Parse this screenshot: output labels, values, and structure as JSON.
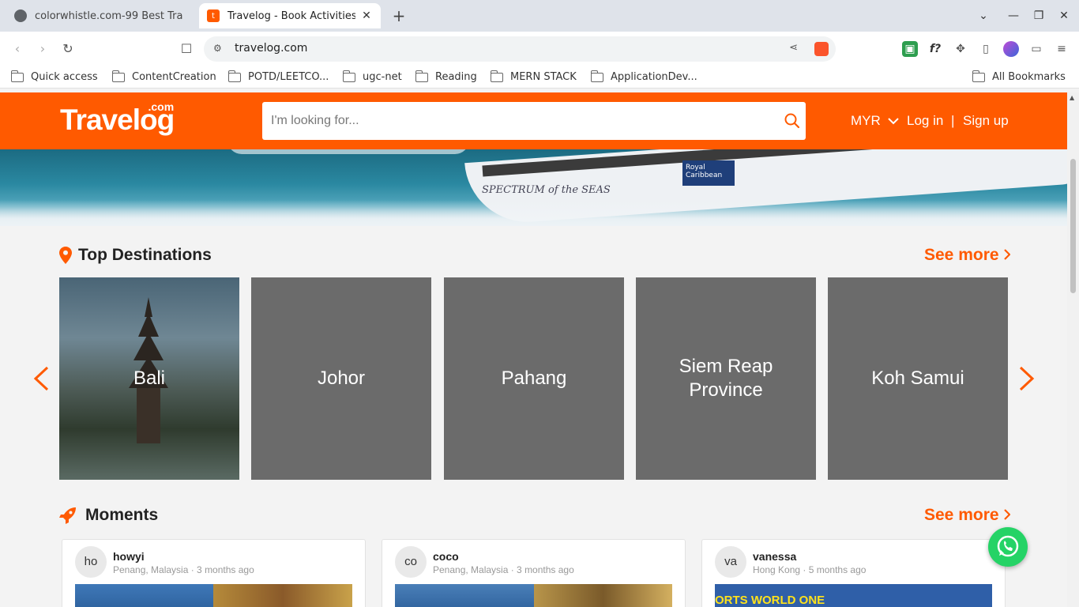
{
  "browser": {
    "tabs": [
      {
        "title": "colorwhistle.com-99 Best Tra",
        "state": "inactive"
      },
      {
        "title": "Travelog - Book Activities",
        "state": "active",
        "favicon_letter": "t"
      }
    ],
    "new_tab_label": "+",
    "url": "travelog.com",
    "bookmarks": [
      "Quick access",
      "ContentCreation",
      "POTD/LEETCO...",
      "ugc-net",
      "Reading",
      "MERN STACK",
      "ApplicationDev..."
    ],
    "all_bookmarks_label": "All Bookmarks",
    "extension_label": "f?"
  },
  "site": {
    "logo_text": "Travelog",
    "logo_suffix": ".com",
    "search_placeholder": "I'm looking for...",
    "currency": "MYR",
    "login": "Log in",
    "separator": "|",
    "signup": "Sign up",
    "accent_color": "#ff5a00"
  },
  "hero": {
    "badge_text": "Royal Caribbean",
    "ship_name": "SPECTRUM of the SEAS"
  },
  "top_destinations": {
    "title": "Top Destinations",
    "see_more": "See more",
    "items": [
      {
        "name": "Bali"
      },
      {
        "name": "Johor"
      },
      {
        "name": "Pahang"
      },
      {
        "name": "Siem Reap Province"
      },
      {
        "name": "Koh Samui"
      }
    ]
  },
  "moments": {
    "title": "Moments",
    "see_more": "See more",
    "items": [
      {
        "initials": "ho",
        "user": "howyi",
        "meta": "Penang, Malaysia · 3 months ago"
      },
      {
        "initials": "co",
        "user": "coco",
        "meta": "Penang, Malaysia · 3 months ago"
      },
      {
        "initials": "va",
        "user": "vanessa",
        "meta": "Hong Kong · 5 months ago",
        "image_text": "ORTS WORLD ONE"
      }
    ]
  }
}
